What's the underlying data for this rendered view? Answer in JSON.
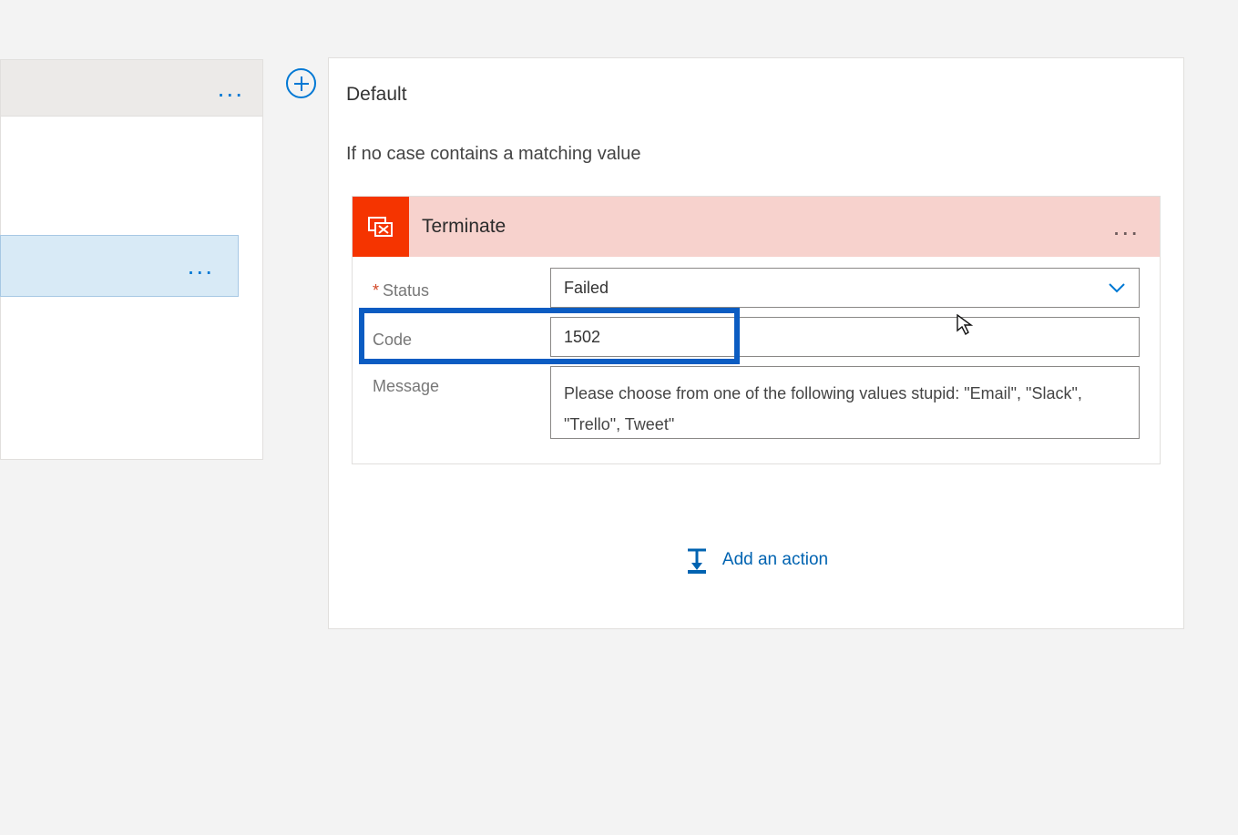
{
  "leftPanel": {
    "ellipsis1": "...",
    "ellipsis2": "..."
  },
  "main": {
    "title": "Default",
    "subtitle": "If no case contains a matching value",
    "action": {
      "header": "Terminate",
      "ellipsis": "...",
      "fields": {
        "statusLabel": "Status",
        "statusValue": "Failed",
        "codeLabel": "Code",
        "codeValue": "1502",
        "messageLabel": "Message",
        "messageValue": "Please choose from one of the following values stupid: \"Email\", \"Slack\", \"Trello\", Tweet\""
      }
    },
    "addAction": "Add an action"
  }
}
